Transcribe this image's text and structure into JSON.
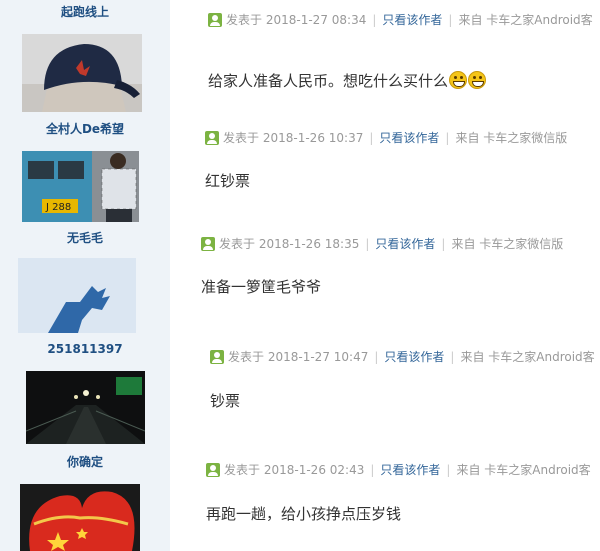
{
  "users": [
    {
      "name": "起跑线上",
      "avatar_icon": "cap-photo-avatar"
    },
    {
      "name": "全村人De希望",
      "avatar_icon": "truck-person-photo-avatar"
    },
    {
      "name": "无毛毛",
      "avatar_icon": "blue-emblem-avatar"
    },
    {
      "name": "251811397",
      "avatar_icon": "night-road-photo-avatar"
    },
    {
      "name": "你确定",
      "avatar_icon": "flag-heart-avatar"
    }
  ],
  "posts": [
    {
      "posted_prefix": "发表于",
      "date": "2018-1-27 08:34",
      "author_only": "只看该作者",
      "source": "来自 卡车之家Android客",
      "content": "给家人准备人民币。想吃什么买什么"
    },
    {
      "posted_prefix": "发表于",
      "date": "2018-1-26 10:37",
      "author_only": "只看该作者",
      "source": "来自 卡车之家微信版",
      "content": "红钞票"
    },
    {
      "posted_prefix": "发表于",
      "date": "2018-1-26 18:35",
      "author_only": "只看该作者",
      "source": "来自 卡车之家微信版",
      "content": "准备一箩筐毛爷爷"
    },
    {
      "posted_prefix": "发表于",
      "date": "2018-1-27 10:47",
      "author_only": "只看该作者",
      "source": "来自 卡车之家Android客",
      "content": "钞票"
    },
    {
      "posted_prefix": "发表于",
      "date": "2018-1-26 02:43",
      "author_only": "只看该作者",
      "source": "来自 卡车之家Android客",
      "content": "再跑一趟，给小孩挣点压岁钱"
    }
  ],
  "separator": "|",
  "colors": {
    "sidebar_bg": "#eef3f8",
    "username": "#1f4f82",
    "meta_text": "#999999",
    "author_link": "#336699",
    "content_text": "#333333",
    "user_icon_green": "#7cb342"
  }
}
